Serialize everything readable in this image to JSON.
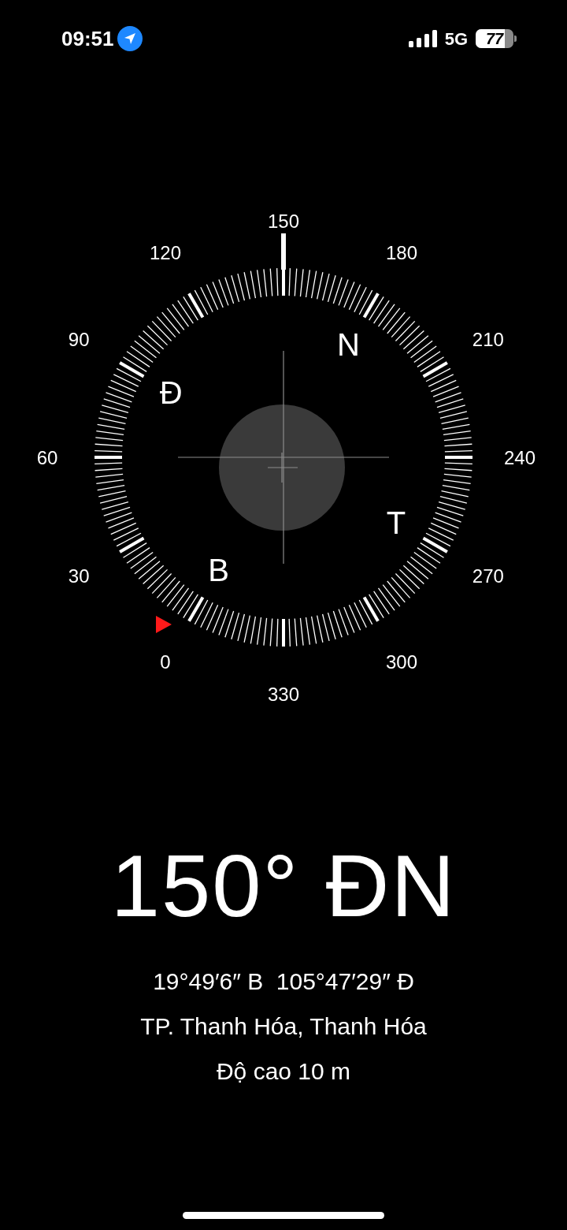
{
  "status_bar": {
    "time": "09:51",
    "network": "5G",
    "battery": "77"
  },
  "compass": {
    "labels": [
      "150",
      "180",
      "210",
      "240",
      "270",
      "300",
      "330",
      "0",
      "30",
      "60",
      "90",
      "120"
    ],
    "cardinals": [
      "N",
      "T",
      "B",
      "Đ"
    ]
  },
  "heading": "150° ĐN",
  "coordinates": "19°49′6″ B  105°47′29″ Đ",
  "place": "TP. Thanh Hóa, Thanh Hóa",
  "altitude": "Độ cao 10 m"
}
